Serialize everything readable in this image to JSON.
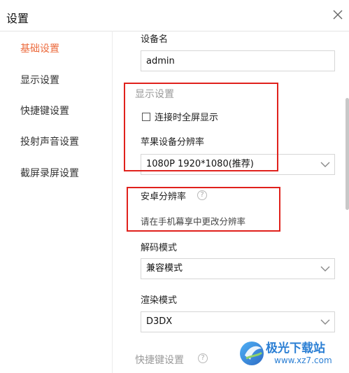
{
  "window": {
    "title": "设置"
  },
  "sidebar": {
    "items": [
      {
        "label": "基础设置"
      },
      {
        "label": "显示设置"
      },
      {
        "label": "快捷键设置"
      },
      {
        "label": "投射声音设置"
      },
      {
        "label": "截屏录屏设置"
      }
    ]
  },
  "main": {
    "device_name": {
      "label": "设备名",
      "value": "admin"
    },
    "display_section": {
      "title": "显示设置",
      "fullscreen_checkbox": {
        "label": "连接时全屏显示",
        "checked": false
      },
      "apple_resolution": {
        "label": "苹果设备分辨率",
        "selected": "1080P 1920*1080(推荐)"
      }
    },
    "android_resolution": {
      "label": "安卓分辨率",
      "help_icon": "?",
      "hint": "请在手机幕享中更改分辨率"
    },
    "decode_mode": {
      "label": "解码模式",
      "selected": "兼容模式"
    },
    "render_mode": {
      "label": "渲染模式",
      "selected": "D3DX"
    },
    "shortcut_section": {
      "title": "快捷键设置",
      "help_icon": "?"
    }
  },
  "watermark": {
    "brand": "极光下载站",
    "url": "www.xz7.com"
  },
  "colors": {
    "active": "#ec6a3c",
    "highlight": "#e0211c",
    "watermark": "#2b7fd4"
  }
}
